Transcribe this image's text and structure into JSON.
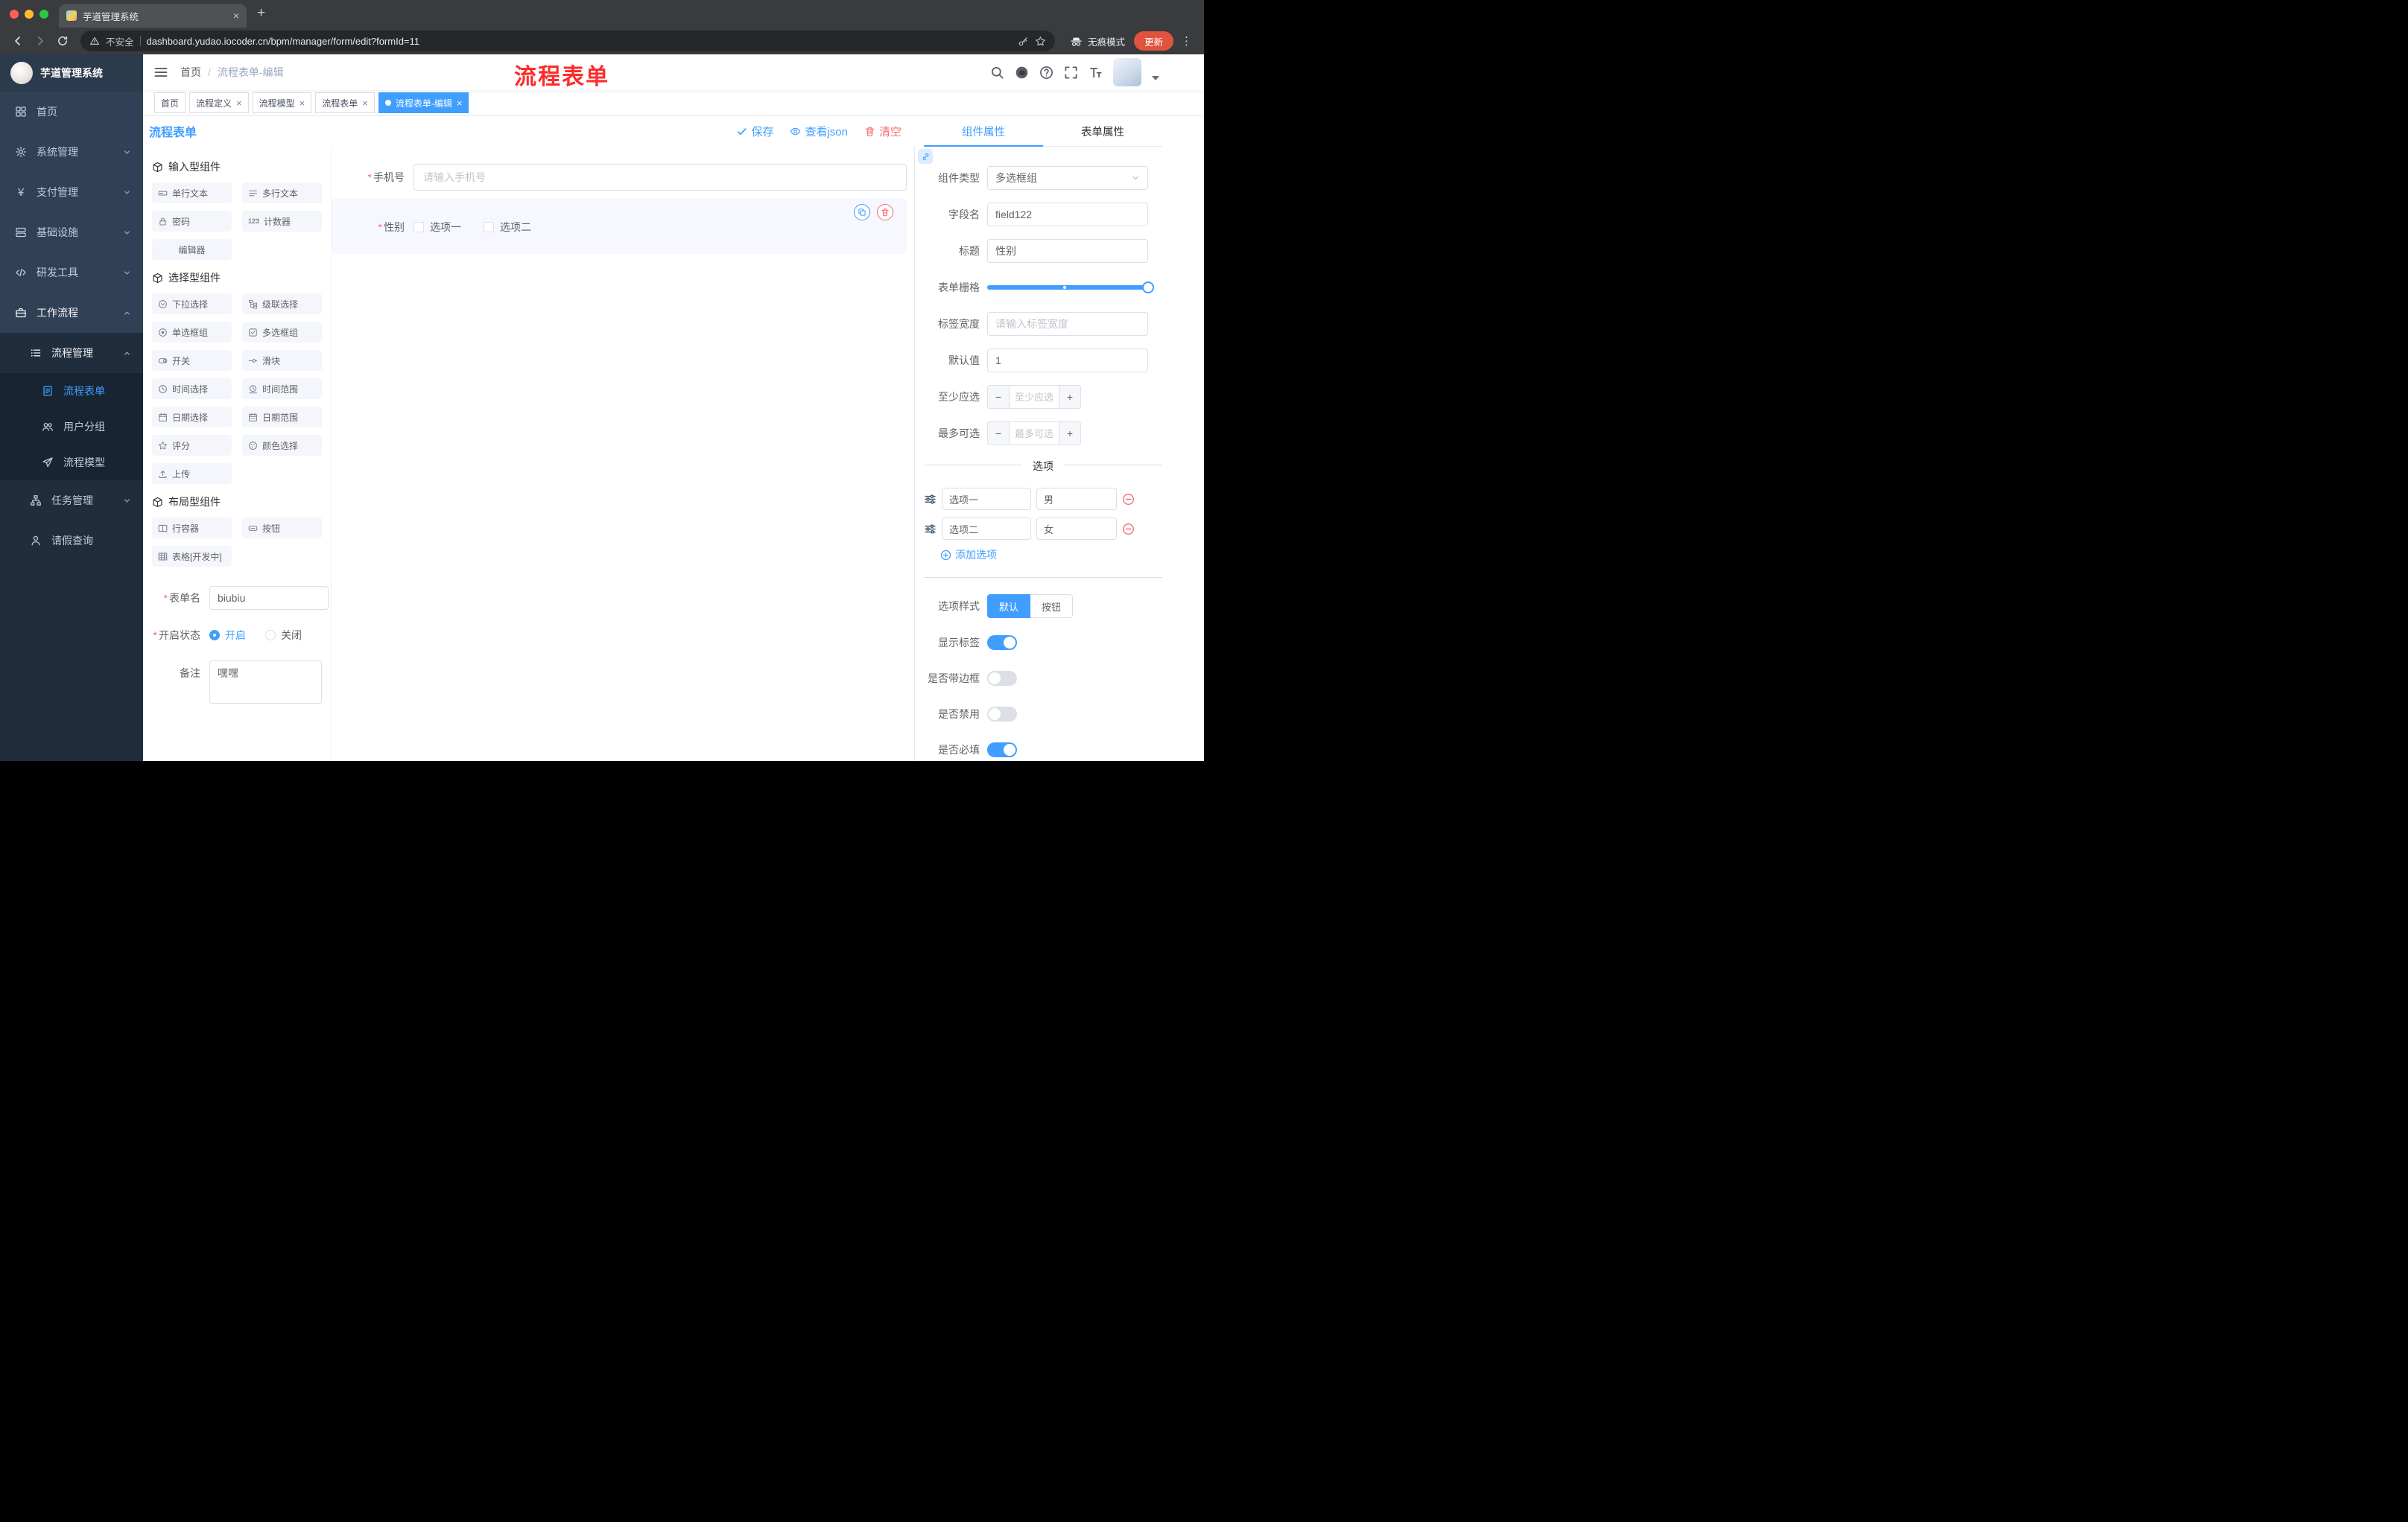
{
  "colors": {
    "primary": "#409EFF",
    "danger": "#F56C6C",
    "annotation_red": "#FE2B2B",
    "sidebar_bg": "#304156"
  },
  "browser": {
    "tab": {
      "title": "芋道管理系统"
    },
    "security_label": "不安全",
    "url": "dashboard.yudao.iocoder.cn/bpm/manager/form/edit?formId=11",
    "incognito_label": "无痕模式",
    "update_label": "更新"
  },
  "sidebar": {
    "logo_title": "芋道管理系统",
    "items": [
      {
        "label": "首页"
      },
      {
        "label": "系统管理"
      },
      {
        "label": "支付管理"
      },
      {
        "label": "基础设施"
      },
      {
        "label": "研发工具"
      },
      {
        "label": "工作流程"
      },
      {
        "label": "流程管理"
      },
      {
        "label": "流程表单"
      },
      {
        "label": "用户分组"
      },
      {
        "label": "流程模型"
      },
      {
        "label": "任务管理"
      },
      {
        "label": "请假查询"
      }
    ]
  },
  "header": {
    "breadcrumb": {
      "home": "首页",
      "current": "流程表单-编辑"
    },
    "annotation": "流程表单"
  },
  "tags": [
    {
      "label": "首页"
    },
    {
      "label": "流程定义"
    },
    {
      "label": "流程模型"
    },
    {
      "label": "流程表单"
    },
    {
      "label": "流程表单-编辑"
    }
  ],
  "designer": {
    "title": "流程表单",
    "actions": {
      "save": "保存",
      "view_json": "查看json",
      "clear": "清空"
    },
    "palette": {
      "sections": [
        {
          "title": "输入型组件"
        },
        {
          "title": "选择型组件"
        },
        {
          "title": "布局型组件"
        }
      ],
      "input_items": [
        "单行文本",
        "多行文本",
        "密码",
        "计数器",
        "编辑器"
      ],
      "select_items": [
        "下拉选择",
        "级联选择",
        "单选框组",
        "多选框组",
        "开关",
        "滑块",
        "时间选择",
        "时间范围",
        "日期选择",
        "日期范围",
        "评分",
        "颜色选择",
        "上传"
      ],
      "layout_items": [
        "行容器",
        "按钮",
        "表格[开发中]"
      ]
    },
    "form_meta": {
      "name_label": "表单名",
      "name_value": "biubiu",
      "status_label": "开启状态",
      "status_on": "开启",
      "status_off": "关闭",
      "remark_label": "备注",
      "remark_value": "嘿嘿"
    },
    "canvas": {
      "phone_label": "手机号",
      "phone_placeholder": "请输入手机号",
      "gender_label": "性别",
      "gender_options": [
        "选项一",
        "选项二"
      ]
    },
    "props": {
      "tabs": [
        "组件属性",
        "表单属性"
      ],
      "component_type_label": "组件类型",
      "component_type_value": "多选框组",
      "field_label": "字段名",
      "field_value": "field122",
      "title_label": "标题",
      "title_value": "性别",
      "grid_label": "表单栅格",
      "label_width_label": "标签宽度",
      "label_width_placeholder": "请输入标签宽度",
      "default_label": "默认值",
      "default_value": "1",
      "min_label": "至少应选",
      "min_placeholder": "至少应选",
      "max_label": "最多可选",
      "max_placeholder": "最多可选",
      "options_title": "选项",
      "options": [
        {
          "label": "选项一",
          "value": "男"
        },
        {
          "label": "选项二",
          "value": "女"
        }
      ],
      "add_option": "添加选项",
      "style_label": "选项样式",
      "style_default": "默认",
      "style_button": "按钮",
      "show_label_label": "显示标签",
      "border_label": "是否带边框",
      "disabled_label": "是否禁用",
      "required_label": "是否必填"
    }
  }
}
